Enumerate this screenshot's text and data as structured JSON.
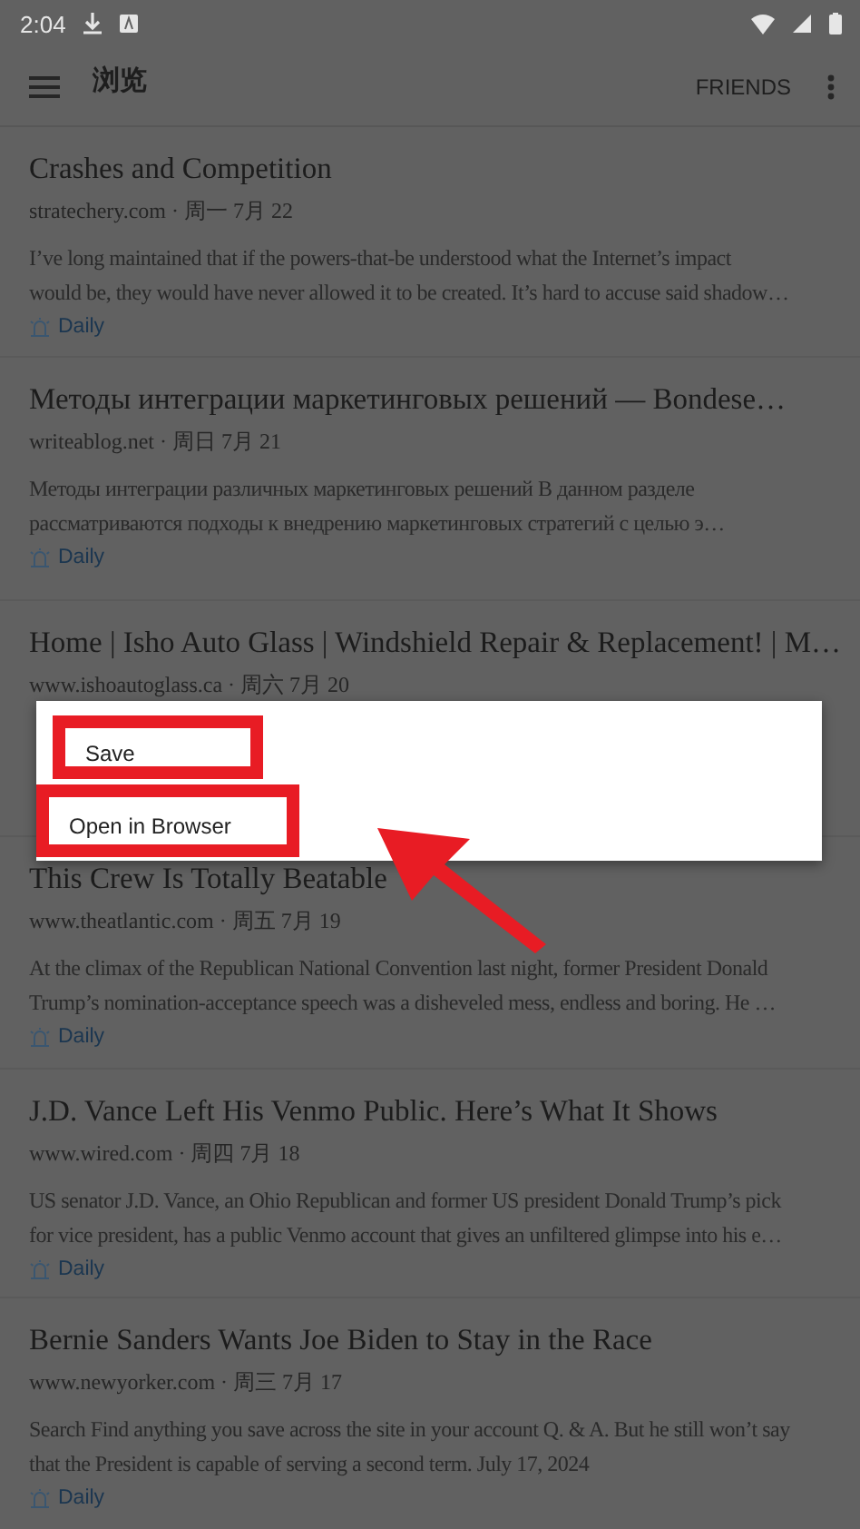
{
  "status_bar": {
    "time": "2:04"
  },
  "toolbar": {
    "title": "浏览",
    "action": "FRIENDS"
  },
  "meta_separator": "·",
  "articles": [
    {
      "title": "Crashes and Competition",
      "source": "stratechery.com",
      "date": "周一 7月 22",
      "excerpt": [
        "I’ve long maintained that if the powers-that-be understood what the Internet’s impact",
        "would be, they would have never allowed it to be created. It’s hard to accuse said shadow…"
      ],
      "tag": "Daily"
    },
    {
      "title": "Методы интеграции маркетинговых решений — Bondese…",
      "source": "writeablog.net",
      "date": "周日 7月 21",
      "excerpt": [
        "Методы интеграции различных маркетинговых решений В данном разделе",
        "рассматриваются подходы к внедрению маркетинговых стратегий с целью э…"
      ],
      "tag": "Daily"
    },
    {
      "title": "Home | Isho Auto Glass | Windshield Repair & Replacement! | M…",
      "source": "www.ishoautoglass.ca",
      "date": "周六 7月 20"
    },
    {
      "title": "This Crew Is Totally Beatable",
      "source": "www.theatlantic.com",
      "date": "周五 7月 19",
      "excerpt": [
        "At the climax of the Republican National Convention last night, former President Donald",
        "Trump’s nomination-acceptance speech was a disheveled mess, endless and boring. He …"
      ],
      "tag": "Daily"
    },
    {
      "title": "J.D. Vance Left His Venmo Public. Here’s What It Shows",
      "source": "www.wired.com",
      "date": "周四 7月 18",
      "excerpt": [
        "US senator J.D. Vance, an Ohio Republican and former US president Donald Trump’s pick",
        "for vice president, has a public Venmo account that gives an unfiltered glimpse into his e…"
      ],
      "tag": "Daily"
    },
    {
      "title": "Bernie Sanders Wants Joe Biden to Stay in the Race",
      "source": "www.newyorker.com",
      "date": "周三 7月 17",
      "excerpt": [
        "Search Find anything you save across the site in your account Q. & A. But he still won’t say",
        "that the President is capable of serving a second term. July 17, 2024"
      ],
      "tag": "Daily"
    }
  ],
  "context_menu": {
    "items": [
      {
        "label": "Save",
        "highlighted": true
      },
      {
        "label": "Open in Browser",
        "highlighted": true
      }
    ]
  }
}
